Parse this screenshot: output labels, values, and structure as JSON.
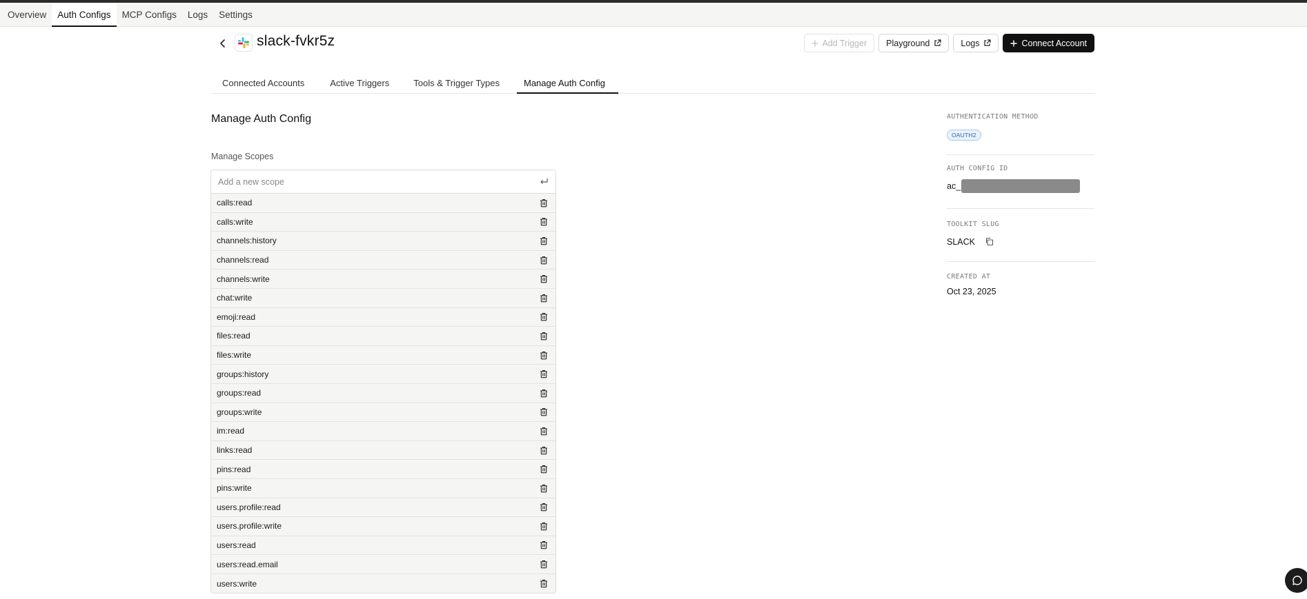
{
  "nav": {
    "items": [
      "Overview",
      "Auth Configs",
      "MCP Configs",
      "Logs",
      "Settings"
    ],
    "active": "Auth Configs"
  },
  "header": {
    "title": "slack-fvkr5z",
    "logo_icon": "slack-logo",
    "actions": {
      "add_trigger": "Add Trigger",
      "playground": "Playground",
      "logs": "Logs",
      "connect_account": "Connect Account"
    }
  },
  "tabs": {
    "items": [
      "Connected Accounts",
      "Active Triggers",
      "Tools & Trigger Types",
      "Manage Auth Config"
    ],
    "active": "Manage Auth Config"
  },
  "main": {
    "section_title": "Manage Auth Config",
    "scopes_label": "Manage Scopes",
    "scope_placeholder": "Add a new scope",
    "scopes": [
      "calls:read",
      "calls:write",
      "channels:history",
      "channels:read",
      "channels:write",
      "chat:write",
      "emoji:read",
      "files:read",
      "files:write",
      "groups:history",
      "groups:read",
      "groups:write",
      "im:read",
      "links:read",
      "pins:read",
      "pins:write",
      "users.profile:read",
      "users.profile:write",
      "users:read",
      "users:read.email",
      "users:write"
    ]
  },
  "sidebar": {
    "auth_method_label": "AUTHENTICATION METHOD",
    "auth_method_value": "OAUTH2",
    "auth_config_id_label": "AUTH CONFIG ID",
    "auth_config_id_prefix": "ac_",
    "toolkit_slug_label": "TOOLKIT SLUG",
    "toolkit_slug_value": "SLACK",
    "created_at_label": "CREATED AT",
    "created_at_value": "Oct 23, 2025"
  },
  "colors": {
    "primary": "#111111",
    "badge_text": "#2b5fa8",
    "badge_bg": "#eaf2fc"
  }
}
